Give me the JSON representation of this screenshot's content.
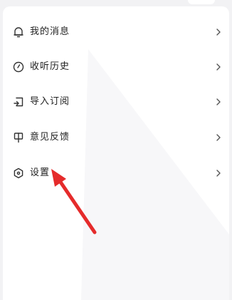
{
  "menu": {
    "items": [
      {
        "label": "我的消息",
        "icon": "bell-icon"
      },
      {
        "label": "收听历史",
        "icon": "clock-icon"
      },
      {
        "label": "导入订阅",
        "icon": "import-icon"
      },
      {
        "label": "意见反馈",
        "icon": "feedback-icon"
      },
      {
        "label": "设置",
        "icon": "settings-icon"
      }
    ],
    "chevron": "chevron-right-icon"
  },
  "annotation": {
    "arrow_color": "#e52b2b",
    "target": "设置"
  }
}
